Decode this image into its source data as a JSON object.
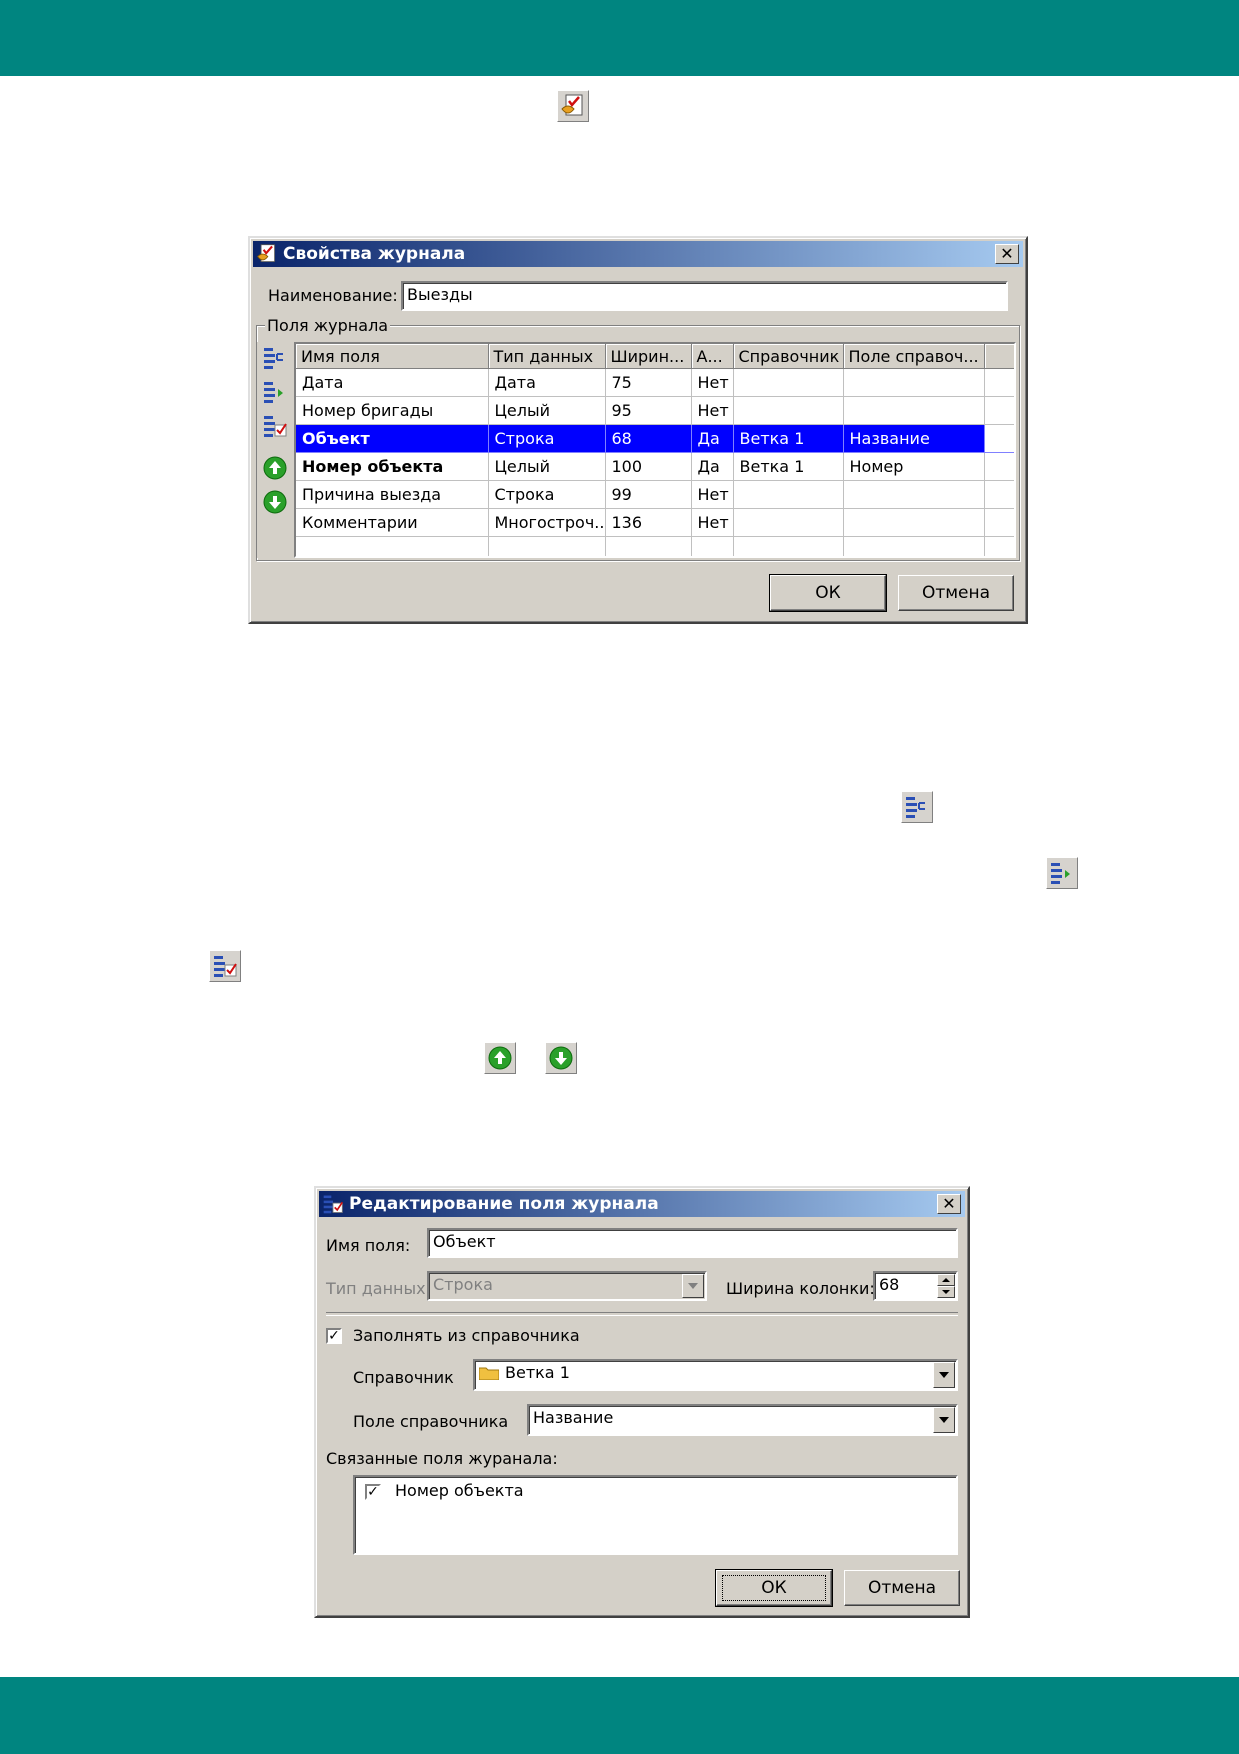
{
  "journal_dialog": {
    "title": "Свойства журнала",
    "name_label": "Наименование:",
    "name_value": "Выезды",
    "group_label": "Поля журнала",
    "columns": [
      "Имя поля",
      "Тип данных",
      "Ширин...",
      "А...",
      "Справочник",
      "Поле справоч..."
    ],
    "rows": [
      [
        "Дата",
        "Дата",
        "75",
        "Нет",
        "",
        ""
      ],
      [
        "Номер бригады",
        "Целый",
        "95",
        "Нет",
        "",
        ""
      ],
      [
        "Объект",
        "Строка",
        "68",
        "Да",
        "Ветка 1",
        "Название"
      ],
      [
        "Номер объекта",
        "Целый",
        "100",
        "Да",
        "Ветка 1",
        "Номер"
      ],
      [
        "Причина выезда",
        "Строка",
        "99",
        "Нет",
        "",
        ""
      ],
      [
        "Комментарии",
        "Многостроч...",
        "136",
        "Нет",
        "",
        ""
      ]
    ],
    "ok_label": "ОК",
    "cancel_label": "Отмена"
  },
  "field_dialog": {
    "title": "Редактирование поля журнала",
    "field_name_label": "Имя поля:",
    "field_name_value": "Объект",
    "data_type_label": "Тип данных:",
    "data_type_value": "Строка",
    "column_width_label": "Ширина колонки:",
    "column_width_value": "68",
    "fill_from_ref_label": "Заполнять из справочника",
    "reference_label": "Справочник",
    "reference_value": "Ветка 1",
    "ref_field_label": "Поле справочника",
    "ref_field_value": "Название",
    "linked_fields_label": "Связанные поля журанала:",
    "linked_fields": [
      "Номер объекта"
    ],
    "ok_label": "ОК",
    "cancel_label": "Отмена"
  },
  "colors": {
    "band": "#008580",
    "selection": "#0000ff",
    "title_gradient_start": "#0a246a",
    "title_gradient_end": "#a6caf0"
  }
}
